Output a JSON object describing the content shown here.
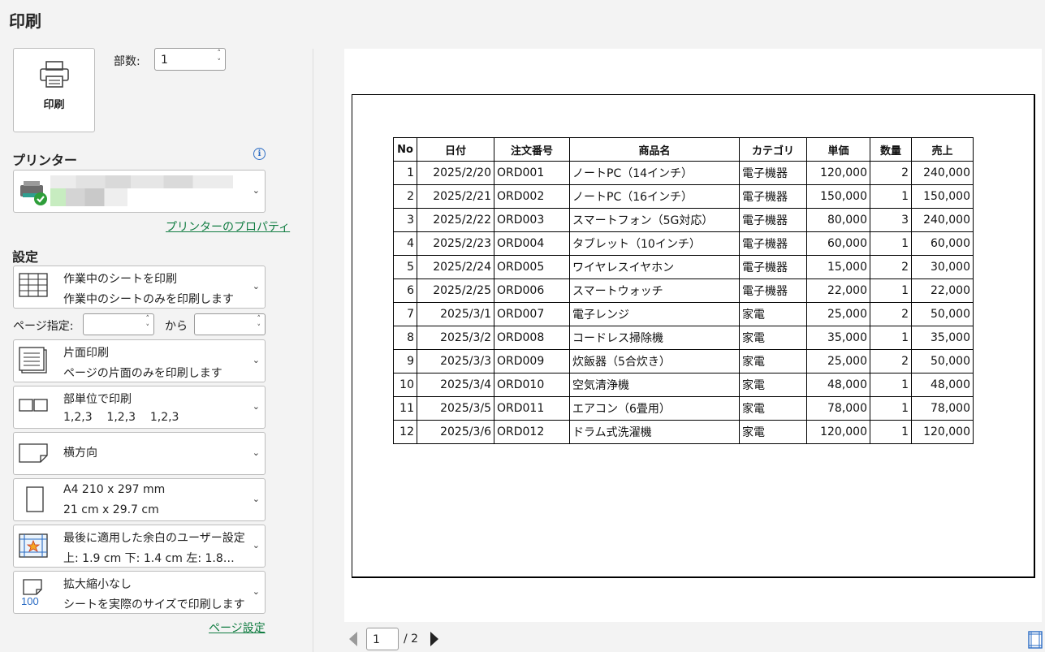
{
  "title": "印刷",
  "print_button": {
    "label": "印刷",
    "icon": "printer-icon"
  },
  "copies": {
    "label": "部数:",
    "value": "1"
  },
  "printer": {
    "section_title": "プリンター",
    "info_icon": "i",
    "properties_link": "プリンターのプロパティ"
  },
  "settings": {
    "section_title": "設定",
    "scope": {
      "line1": "作業中のシートを印刷",
      "line2": "作業中のシートのみを印刷します"
    },
    "page_range": {
      "label": "ページ指定:",
      "from_value": "",
      "to_label": "から",
      "to_value": ""
    },
    "sides": {
      "line1": "片面印刷",
      "line2": "ページの片面のみを印刷します"
    },
    "collate": {
      "line1": "部単位で印刷",
      "line2": "1,2,3    1,2,3    1,2,3"
    },
    "orientation": {
      "line1": "横方向"
    },
    "paper": {
      "line1": "A4 210 x 297 mm",
      "line2": "21 cm x 29.7 cm"
    },
    "margins": {
      "line1": "最後に適用した余白のユーザー設定",
      "line2": "上: 1.9 cm 下: 1.4 cm 左: 1.8…"
    },
    "scaling": {
      "line1": "拡大縮小なし",
      "line2": "シートを実際のサイズで印刷します",
      "icon_text": "100"
    },
    "page_setup_link": "ページ設定"
  },
  "preview": {
    "headers": [
      "No",
      "日付",
      "注文番号",
      "商品名",
      "カテゴリ",
      "単価",
      "数量",
      "売上"
    ],
    "rows": [
      [
        "1",
        "2025/2/20",
        "ORD001",
        "ノートPC（14インチ）",
        "電子機器",
        "120,000",
        "2",
        "240,000"
      ],
      [
        "2",
        "2025/2/21",
        "ORD002",
        "ノートPC（16インチ）",
        "電子機器",
        "150,000",
        "1",
        "150,000"
      ],
      [
        "3",
        "2025/2/22",
        "ORD003",
        "スマートフォン（5G対応）",
        "電子機器",
        "80,000",
        "3",
        "240,000"
      ],
      [
        "4",
        "2025/2/23",
        "ORD004",
        "タブレット（10インチ）",
        "電子機器",
        "60,000",
        "1",
        "60,000"
      ],
      [
        "5",
        "2025/2/24",
        "ORD005",
        "ワイヤレスイヤホン",
        "電子機器",
        "15,000",
        "2",
        "30,000"
      ],
      [
        "6",
        "2025/2/25",
        "ORD006",
        "スマートウォッチ",
        "電子機器",
        "22,000",
        "1",
        "22,000"
      ],
      [
        "7",
        "2025/3/1",
        "ORD007",
        "電子レンジ",
        "家電",
        "25,000",
        "2",
        "50,000"
      ],
      [
        "8",
        "2025/3/2",
        "ORD008",
        "コードレス掃除機",
        "家電",
        "35,000",
        "1",
        "35,000"
      ],
      [
        "9",
        "2025/3/3",
        "ORD009",
        "炊飯器（5合炊き）",
        "家電",
        "25,000",
        "2",
        "50,000"
      ],
      [
        "10",
        "2025/3/4",
        "ORD010",
        "空気清浄機",
        "家電",
        "48,000",
        "1",
        "48,000"
      ],
      [
        "11",
        "2025/3/5",
        "ORD011",
        "エアコン（6畳用）",
        "家電",
        "78,000",
        "1",
        "78,000"
      ],
      [
        "12",
        "2025/3/6",
        "ORD012",
        "ドラム式洗濯機",
        "家電",
        "120,000",
        "1",
        "120,000"
      ]
    ]
  },
  "pager": {
    "current": "1",
    "total": "/ 2"
  }
}
